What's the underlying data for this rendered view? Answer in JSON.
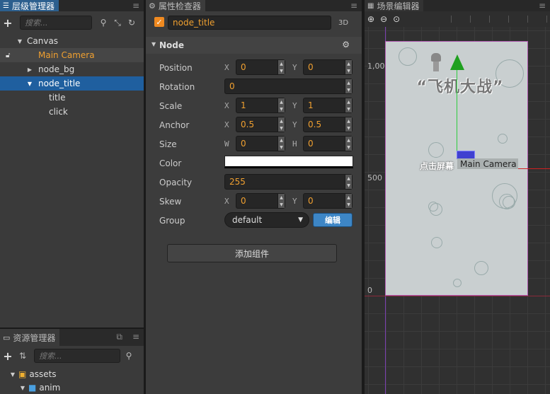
{
  "hierarchy": {
    "title": "层级管理器",
    "search_placeholder": "搜索...",
    "tree": [
      {
        "label": "Canvas"
      },
      {
        "label": "Main Camera"
      },
      {
        "label": "node_bg"
      },
      {
        "label": "node_title"
      },
      {
        "label": "title"
      },
      {
        "label": "click"
      }
    ]
  },
  "assets": {
    "title": "资源管理器",
    "search_placeholder": "搜索...",
    "tree": [
      {
        "label": "assets"
      },
      {
        "label": "anim"
      }
    ]
  },
  "inspector": {
    "title": "属性检查器",
    "node_name": "node_title",
    "badge_3d": "3D",
    "section": "Node",
    "props": {
      "position": {
        "label": "Position",
        "x_axis": "X",
        "x": "0",
        "y_axis": "Y",
        "y": "0"
      },
      "rotation": {
        "label": "Rotation",
        "value": "0"
      },
      "scale": {
        "label": "Scale",
        "x_axis": "X",
        "x": "1",
        "y_axis": "Y",
        "y": "1"
      },
      "anchor": {
        "label": "Anchor",
        "x_axis": "X",
        "x": "0.5",
        "y_axis": "Y",
        "y": "0.5"
      },
      "size": {
        "label": "Size",
        "w_axis": "W",
        "w": "0",
        "h_axis": "H",
        "h": "0"
      },
      "color": {
        "label": "Color",
        "value": "#ffffff"
      },
      "opacity": {
        "label": "Opacity",
        "value": "255"
      },
      "skew": {
        "label": "Skew",
        "x_axis": "X",
        "x": "0",
        "y_axis": "Y",
        "y": "0"
      },
      "group": {
        "label": "Group",
        "value": "default",
        "edit_label": "编辑"
      }
    },
    "add_component": "添加组件"
  },
  "scene": {
    "title": "场景编辑器",
    "ruler_y": [
      "1,000",
      "500",
      "0"
    ],
    "game_title": "“飞机大战”",
    "click_text": "点击屏幕",
    "camera_label": "Main Camera"
  },
  "colors": {
    "accent_blue": "#1f5f9f",
    "value_orange": "#f0a030",
    "edit_button": "#3d86c6"
  }
}
